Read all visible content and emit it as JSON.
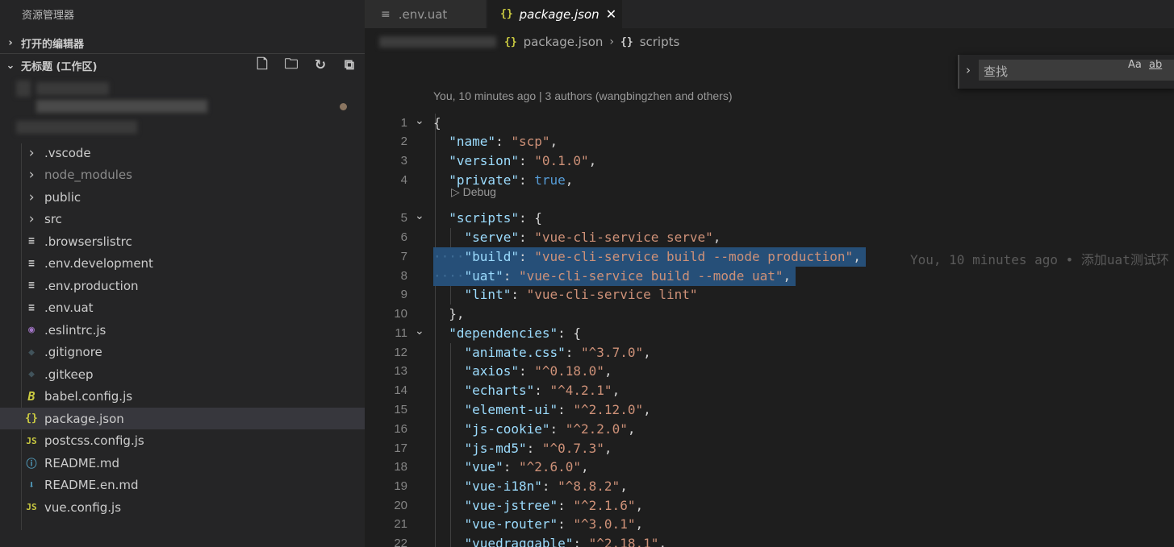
{
  "sidebar": {
    "title": "资源管理器",
    "open_editors": "打开的编辑器",
    "workspace": "无标题 (工作区)",
    "actions": [
      {
        "name": "new-file-icon",
        "glyph": "🗋"
      },
      {
        "name": "new-folder-icon",
        "glyph": "🗀"
      },
      {
        "name": "refresh-icon",
        "glyph": "↻"
      },
      {
        "name": "collapse-all-icon",
        "glyph": "⧉"
      }
    ],
    "items": [
      {
        "label": ".vscode",
        "kind": "folder"
      },
      {
        "label": "node_modules",
        "kind": "folder",
        "dim": true
      },
      {
        "label": "public",
        "kind": "folder"
      },
      {
        "label": "src",
        "kind": "folder"
      },
      {
        "label": ".browserslistrc",
        "kind": "text",
        "icon": "≡",
        "color": "#cccccc"
      },
      {
        "label": ".env.development",
        "kind": "text",
        "icon": "≡",
        "color": "#cccccc"
      },
      {
        "label": ".env.production",
        "kind": "text",
        "icon": "≡",
        "color": "#cccccc"
      },
      {
        "label": ".env.uat",
        "kind": "text",
        "icon": "≡",
        "color": "#cccccc"
      },
      {
        "label": ".eslintrc.js",
        "kind": "eslint",
        "icon": "◉",
        "color": "#a074c4"
      },
      {
        "label": ".gitignore",
        "kind": "git",
        "icon": "◆",
        "color": "#41535b"
      },
      {
        "label": ".gitkeep",
        "kind": "git",
        "icon": "◆",
        "color": "#41535b"
      },
      {
        "label": "babel.config.js",
        "kind": "babel",
        "icon": "B",
        "color": "#cbcb41"
      },
      {
        "label": "package.json",
        "kind": "json",
        "icon": "{}",
        "color": "#cbcb41",
        "selected": true
      },
      {
        "label": "postcss.config.js",
        "kind": "js",
        "icon": "JS",
        "color": "#cbcb41"
      },
      {
        "label": "README.md",
        "kind": "info",
        "icon": "ⓘ",
        "color": "#519aba"
      },
      {
        "label": "README.en.md",
        "kind": "download",
        "icon": "⬇",
        "color": "#519aba"
      },
      {
        "label": "vue.config.js",
        "kind": "js",
        "icon": "JS",
        "color": "#cbcb41"
      }
    ]
  },
  "tabs": [
    {
      "label": ".env.uat",
      "icon": "≡",
      "active": false
    },
    {
      "label": "package.json",
      "icon": "{}",
      "active": true,
      "close": "✕"
    }
  ],
  "breadcrumb": {
    "file": "package.json",
    "file_icon": "{}",
    "separator": "›",
    "symbol": "scripts",
    "symbol_icon": "{}"
  },
  "find": {
    "placeholder": "查找",
    "match_case": "Aa",
    "whole_word": "ab"
  },
  "editor": {
    "codelens_authors": "You, 10 minutes ago | 3 authors (wangbingzhen and others)",
    "codelens_debug": "▷ Debug",
    "blame": "You, 10 minutes ago • 添加uat测试环",
    "lines": [
      {
        "n": "1",
        "fold": true,
        "indent": 0,
        "tokens": [
          [
            "p",
            "{"
          ]
        ]
      },
      {
        "n": "2",
        "indent": 1,
        "tokens": [
          [
            "k",
            "\"name\""
          ],
          [
            "p",
            ": "
          ],
          [
            "s",
            "\"scp\""
          ],
          [
            "p",
            ","
          ]
        ]
      },
      {
        "n": "3",
        "indent": 1,
        "tokens": [
          [
            "k",
            "\"version\""
          ],
          [
            "p",
            ": "
          ],
          [
            "s",
            "\"0.1.0\""
          ],
          [
            "p",
            ","
          ]
        ]
      },
      {
        "n": "4",
        "indent": 1,
        "tokens": [
          [
            "k",
            "\"private\""
          ],
          [
            "p",
            ": "
          ],
          [
            "b",
            "true"
          ],
          [
            "p",
            ","
          ]
        ]
      },
      {
        "n": "5",
        "fold": true,
        "indent": 1,
        "tokens": [
          [
            "k",
            "\"scripts\""
          ],
          [
            "p",
            ": {"
          ]
        ]
      },
      {
        "n": "6",
        "indent": 2,
        "tokens": [
          [
            "k",
            "\"serve\""
          ],
          [
            "p",
            ": "
          ],
          [
            "s",
            "\"vue-cli-service serve\""
          ],
          [
            "p",
            ","
          ]
        ]
      },
      {
        "n": "7",
        "indent": 2,
        "selected": true,
        "tokens": [
          [
            "k",
            "\"build\""
          ],
          [
            "p",
            ": "
          ],
          [
            "s",
            "\"vue-cli-service build --mode production\""
          ],
          [
            "p",
            ","
          ]
        ]
      },
      {
        "n": "8",
        "indent": 2,
        "selected": true,
        "tokens": [
          [
            "k",
            "\"uat\""
          ],
          [
            "p",
            ": "
          ],
          [
            "s",
            "\"vue-cli-service build --mode uat\""
          ],
          [
            "p",
            ","
          ]
        ]
      },
      {
        "n": "9",
        "indent": 2,
        "tokens": [
          [
            "k",
            "\"lint\""
          ],
          [
            "p",
            ": "
          ],
          [
            "s",
            "\"vue-cli-service lint\""
          ]
        ]
      },
      {
        "n": "10",
        "indent": 1,
        "tokens": [
          [
            "p",
            "},"
          ]
        ]
      },
      {
        "n": "11",
        "fold": true,
        "indent": 1,
        "tokens": [
          [
            "k",
            "\"dependencies\""
          ],
          [
            "p",
            ": {"
          ]
        ]
      },
      {
        "n": "12",
        "indent": 2,
        "tokens": [
          [
            "k",
            "\"animate.css\""
          ],
          [
            "p",
            ": "
          ],
          [
            "s",
            "\"^3.7.0\""
          ],
          [
            "p",
            ","
          ]
        ]
      },
      {
        "n": "13",
        "indent": 2,
        "tokens": [
          [
            "k",
            "\"axios\""
          ],
          [
            "p",
            ": "
          ],
          [
            "s",
            "\"^0.18.0\""
          ],
          [
            "p",
            ","
          ]
        ]
      },
      {
        "n": "14",
        "indent": 2,
        "tokens": [
          [
            "k",
            "\"echarts\""
          ],
          [
            "p",
            ": "
          ],
          [
            "s",
            "\"^4.2.1\""
          ],
          [
            "p",
            ","
          ]
        ]
      },
      {
        "n": "15",
        "indent": 2,
        "tokens": [
          [
            "k",
            "\"element-ui\""
          ],
          [
            "p",
            ": "
          ],
          [
            "s",
            "\"^2.12.0\""
          ],
          [
            "p",
            ","
          ]
        ]
      },
      {
        "n": "16",
        "indent": 2,
        "tokens": [
          [
            "k",
            "\"js-cookie\""
          ],
          [
            "p",
            ": "
          ],
          [
            "s",
            "\"^2.2.0\""
          ],
          [
            "p",
            ","
          ]
        ]
      },
      {
        "n": "17",
        "indent": 2,
        "tokens": [
          [
            "k",
            "\"js-md5\""
          ],
          [
            "p",
            ": "
          ],
          [
            "s",
            "\"^0.7.3\""
          ],
          [
            "p",
            ","
          ]
        ]
      },
      {
        "n": "18",
        "indent": 2,
        "tokens": [
          [
            "k",
            "\"vue\""
          ],
          [
            "p",
            ": "
          ],
          [
            "s",
            "\"^2.6.0\""
          ],
          [
            "p",
            ","
          ]
        ]
      },
      {
        "n": "19",
        "indent": 2,
        "tokens": [
          [
            "k",
            "\"vue-i18n\""
          ],
          [
            "p",
            ": "
          ],
          [
            "s",
            "\"^8.8.2\""
          ],
          [
            "p",
            ","
          ]
        ]
      },
      {
        "n": "20",
        "indent": 2,
        "tokens": [
          [
            "k",
            "\"vue-jstree\""
          ],
          [
            "p",
            ": "
          ],
          [
            "s",
            "\"^2.1.6\""
          ],
          [
            "p",
            ","
          ]
        ]
      },
      {
        "n": "21",
        "indent": 2,
        "tokens": [
          [
            "k",
            "\"vue-router\""
          ],
          [
            "p",
            ": "
          ],
          [
            "s",
            "\"^3.0.1\""
          ],
          [
            "p",
            ","
          ]
        ]
      },
      {
        "n": "22",
        "indent": 2,
        "tokens": [
          [
            "k",
            "\"vuedraggable\""
          ],
          [
            "p",
            ": "
          ],
          [
            "s",
            "\"^2.18.1\""
          ],
          [
            "p",
            ","
          ]
        ]
      }
    ]
  },
  "colors": {
    "selection": "#264f78",
    "key": "#9cdcfe",
    "string": "#ce9178",
    "boolean": "#569cd6"
  }
}
